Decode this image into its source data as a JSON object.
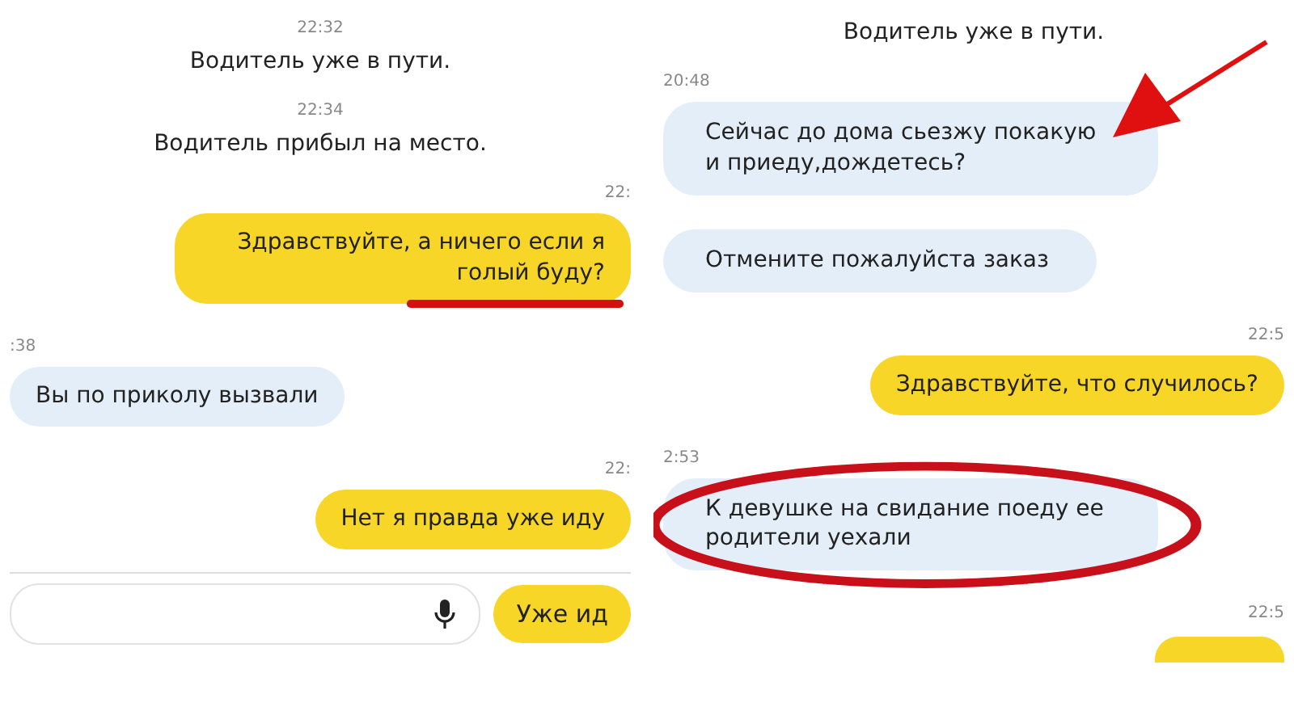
{
  "panels": [
    {
      "messages": [
        {
          "kind": "system",
          "time": "22:32",
          "text": "Водитель уже в пути."
        },
        {
          "kind": "system",
          "time": "22:34",
          "text": "Водитель прибыл на место."
        },
        {
          "kind": "outgoing",
          "time": "22:",
          "text": "Здравствуйте, а ничего если я голый буду?",
          "annotation": {
            "kind": "underline"
          }
        },
        {
          "kind": "incoming",
          "time": ":38",
          "text": "Вы по приколу вызвали"
        },
        {
          "kind": "outgoing",
          "time": "22:",
          "text": "Нет я правда уже иду"
        }
      ],
      "composer": {
        "quick_reply": "Уже ид"
      }
    },
    {
      "messages": [
        {
          "kind": "system",
          "text": "Водитель уже в пути."
        },
        {
          "kind": "incoming",
          "time": "20:48",
          "text": "Сейчас до дома сьезжу покакую и приеду,дождетесь?",
          "annotation": {
            "kind": "arrow"
          }
        },
        {
          "kind": "incoming",
          "text": "Отмените пожалуйста заказ"
        },
        {
          "kind": "outgoing",
          "time": "22:5",
          "text": "Здравствуйте, что случилось?"
        },
        {
          "kind": "incoming",
          "time": "2:53",
          "text": "К девушке на свидание поеду ее родители уехали",
          "annotation": {
            "kind": "ellipse"
          }
        },
        {
          "kind": "stub",
          "time": "22:5"
        }
      ]
    }
  ]
}
